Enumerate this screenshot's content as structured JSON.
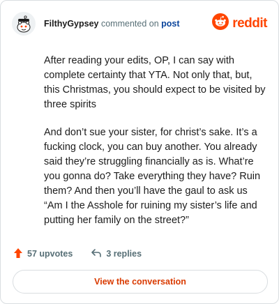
{
  "header": {
    "username": "FilthyGypsey",
    "action_text": "commented on",
    "target_link": "post",
    "brand": "reddit"
  },
  "comment": {
    "paragraphs": [
      "After reading your edits, OP, I can say with complete certainty that YTA. Not only that, but, this Christmas, you should expect to be visited by three spirits",
      "And don’t sue your sister, for christ’s sake. It’s a fucking clock, you can buy another. You already said they’re struggling financially as is. What’re you gonna do? Take everything they have? Ruin them? And then you’ll have the gaul to ask us “Am I the Asshole for ruining my sister’s life and putting her family on the street?”"
    ]
  },
  "actions": {
    "upvotes_label": "57 upvotes",
    "replies_label": "3 replies"
  },
  "cta": {
    "label": "View the conversation"
  },
  "colors": {
    "brand_orange": "#ff4500",
    "link_blue": "#0a449b",
    "cta_text": "#d93a00",
    "muted": "#576f76"
  },
  "icons": [
    "reddit-snoo-avatar-icon",
    "reddit-logo-icon",
    "upvote-arrow-icon",
    "reply-arrow-icon"
  ]
}
